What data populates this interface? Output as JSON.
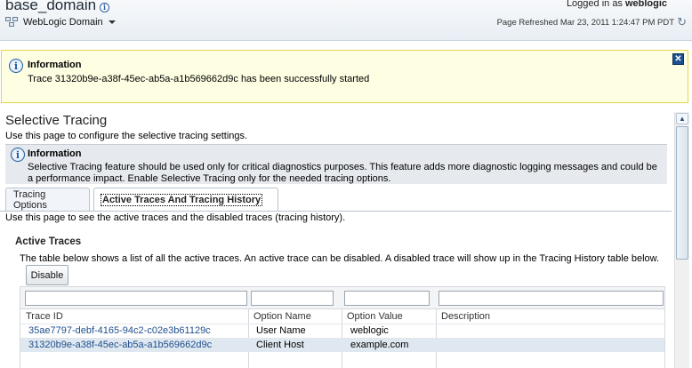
{
  "header": {
    "domain_title": "base_domain",
    "domain_menu_label": "WebLogic Domain",
    "logged_in_prefix": "Logged in as",
    "logged_in_user": "weblogic",
    "page_refreshed": "Page Refreshed Mar 23, 2011 1:24:47 PM PDT"
  },
  "banner": {
    "title": "Information",
    "message": "Trace 31320b9e-a38f-45ec-ab5a-a1b569662d9c has been successfully started"
  },
  "section": {
    "title": "Selective Tracing",
    "description": "Use this page to configure the selective tracing settings.",
    "info_title": "Information",
    "info_message": "Selective Tracing feature should be used only for critical diagnostics purposes. This feature adds more diagnostic logging messages and could be a performance impact. Enable Selective Tracing only for the needed tracing options."
  },
  "tabs": [
    {
      "label": "Tracing Options",
      "selected": false
    },
    {
      "label": "Active Traces And Tracing History",
      "selected": true
    }
  ],
  "panel": {
    "description": "Use this page to see the active traces and the disabled traces (tracing history).",
    "subsection_title": "Active Traces",
    "subsection_description": "The table below shows a list of all the active traces. An active trace can be disabled. A disabled trace will show up in the Tracing History table below.",
    "disable_button": "Disable"
  },
  "table": {
    "columns": [
      "Trace ID",
      "Option Name",
      "Option Value",
      "Description"
    ],
    "rows": [
      {
        "trace_id": "35ae7797-debf-4165-94c2-c02e3b61129c",
        "option_name": "User Name",
        "option_value": "weblogic",
        "description": ""
      },
      {
        "trace_id": "31320b9e-a38f-45ec-ab5a-a1b569662d9c",
        "option_name": "Client Host",
        "option_value": "example.com",
        "description": ""
      }
    ],
    "selected_row": 1
  },
  "colors": {
    "link": "#1f4e8c",
    "banner_bg": "#fefee3",
    "selected_row_bg": "#dfe8f0"
  }
}
